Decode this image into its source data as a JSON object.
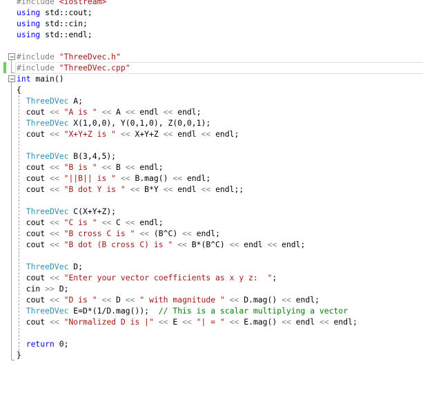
{
  "editor": {
    "language": "C++",
    "current_line": 6,
    "changed_line": 6,
    "colors": {
      "keyword": "#0000ff",
      "string": "#a31515",
      "type": "#2b91af",
      "operator": "#808080",
      "comment": "#008000",
      "change_bar": "#6ccf5c"
    },
    "lines": [
      "#include <iostream>",
      "using std::cout;",
      "using std::cin;",
      "using std::endl;",
      "",
      "#include \"ThreeDvec.h\"",
      "#include \"ThreeDVec.cpp\"",
      "int main()",
      "{",
      "  ThreeDVec A;",
      "  cout << \"A is \" << A << endl << endl;",
      "  ThreeDVec X(1,0,0), Y(0,1,0), Z(0,0,1);",
      "  cout << \"X+Y+Z is \" << X+Y+Z << endl << endl;",
      "",
      "  ThreeDVec B(3,4,5);",
      "  cout << \"B is \" << B << endl;",
      "  cout << \"||B|| is \" << B.mag() << endl;",
      "  cout << \"B dot Y is \" << B*Y << endl << endl;;",
      "",
      "  ThreeDVec C(X+Y+Z);",
      "  cout << \"C is \" << C << endl;",
      "  cout << \"B cross C is \" << (B^C) << endl;",
      "  cout << \"B dot (B cross C) is \" << B*(B^C) << endl << endl;",
      "",
      "  ThreeDVec D;",
      "  cout << \"Enter your vector coefficients as x y z:  \";",
      "  cin >> D;",
      "  cout << \"D is \" << D << \" with magnitude \" << D.mag() << endl;",
      "  ThreeDVec E=D*(1/D.mag());  // This is a scalar multiplying a vector",
      "  cout << \"Normalized D is |\" << E << \"| = \" << E.mag() << endl << endl;",
      "",
      "  return 0;",
      "}"
    ]
  }
}
